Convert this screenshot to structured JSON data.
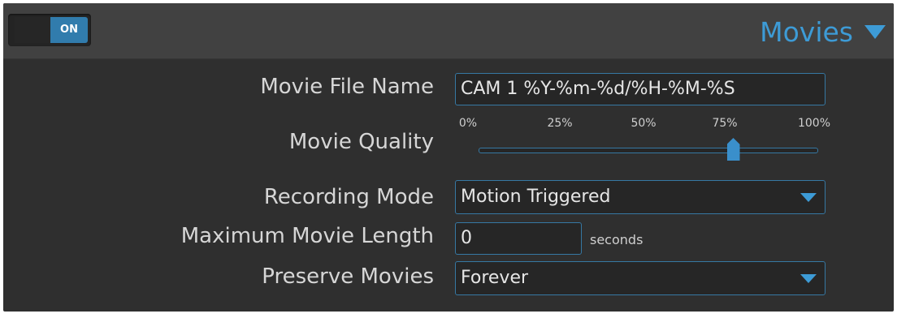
{
  "header": {
    "toggle_label": "ON",
    "toggle_state": true,
    "section_title": "Movies"
  },
  "fields": {
    "movie_file_name": {
      "label": "Movie File Name",
      "value": "CAM 1 %Y-%m-%d/%H-%M-%S"
    },
    "movie_quality": {
      "label": "Movie Quality",
      "tick_labels": [
        "0%",
        "25%",
        "50%",
        "75%",
        "100%"
      ],
      "value_percent": 75
    },
    "recording_mode": {
      "label": "Recording Mode",
      "selected": "Motion Triggered"
    },
    "max_movie_length": {
      "label": "Maximum Movie Length",
      "value": "0",
      "suffix": "seconds"
    },
    "preserve_movies": {
      "label": "Preserve Movies",
      "selected": "Forever"
    }
  },
  "colors": {
    "accent": "#3d9bd6",
    "toggle_on": "#317cad",
    "panel_bg": "#2f2f2f",
    "header_bg": "#414141",
    "field_border": "#3678a3"
  }
}
